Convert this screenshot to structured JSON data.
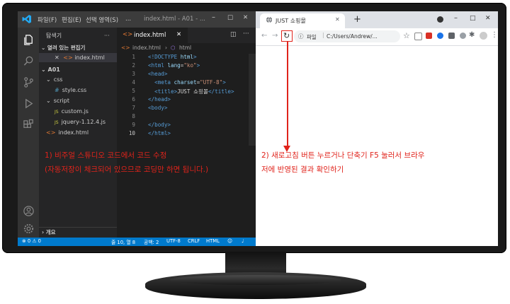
{
  "vscode": {
    "menu": [
      "파일(F)",
      "편집(E)",
      "선택 영역(S)",
      "..."
    ],
    "window_title": "index.html - A01 - ...",
    "explorer_title": "탐색기",
    "more": "···",
    "open_editors": "열려 있는 편집기",
    "open_file": "index.html",
    "folder_root": "A01",
    "tree": [
      {
        "label": "css",
        "kind": "folder",
        "level": 1
      },
      {
        "label": "style.css",
        "kind": "css",
        "level": 2
      },
      {
        "label": "script",
        "kind": "folder",
        "level": 1
      },
      {
        "label": "custom.js",
        "kind": "js",
        "level": 2
      },
      {
        "label": "jquery-1.12.4.js",
        "kind": "js",
        "level": 2
      },
      {
        "label": "index.html",
        "kind": "html",
        "level": 1
      }
    ],
    "outline": "개요",
    "tab_label": "index.html",
    "breadcrumb": [
      "index.html",
      "html"
    ],
    "code_lines": [
      [
        {
          "t": "<!DOCTYPE ",
          "c": "#569cd6"
        },
        {
          "t": "html",
          "c": "#9cdcfe"
        },
        {
          "t": ">",
          "c": "#569cd6"
        }
      ],
      [
        {
          "t": "<html ",
          "c": "#569cd6"
        },
        {
          "t": "lang",
          "c": "#9cdcfe"
        },
        {
          "t": "=",
          "c": "#d4d4d4"
        },
        {
          "t": "\"ko\"",
          "c": "#ce9178"
        },
        {
          "t": ">",
          "c": "#569cd6"
        }
      ],
      [
        {
          "t": "<head>",
          "c": "#569cd6"
        }
      ],
      [
        {
          "t": "  <meta ",
          "c": "#569cd6"
        },
        {
          "t": "charset",
          "c": "#9cdcfe"
        },
        {
          "t": "=",
          "c": "#d4d4d4"
        },
        {
          "t": "\"UTF-8\"",
          "c": "#ce9178"
        },
        {
          "t": ">",
          "c": "#569cd6"
        }
      ],
      [
        {
          "t": "  <title>",
          "c": "#569cd6"
        },
        {
          "t": "JUST 쇼핑몰",
          "c": "#d4d4d4"
        },
        {
          "t": "</title>",
          "c": "#569cd6"
        }
      ],
      [
        {
          "t": "</head>",
          "c": "#569cd6"
        }
      ],
      [
        {
          "t": "<body>",
          "c": "#569cd6"
        }
      ],
      [],
      [
        {
          "t": "</body>",
          "c": "#569cd6"
        }
      ],
      [
        {
          "t": "</html>",
          "c": "#569cd6"
        }
      ]
    ],
    "status": {
      "problems": "⊗ 0 ⚠ 0",
      "position": "줄 10, 열 8",
      "spaces": "공백: 2",
      "encoding": "UTF-8",
      "eol": "CRLF",
      "language": "HTML"
    }
  },
  "chrome": {
    "tab_title": "JUST 쇼핑몰",
    "address_label": "파일",
    "address": "C:/Users/Andrew/...",
    "new_tab": "+"
  },
  "annotations": {
    "left_line1": "1) 비주얼 스튜디오 코드에서 코드 수정",
    "left_line2": "(자동저장이 체크되어 있으므로 코딩만 하면 됩니다.)",
    "right_line1": "2) 새로고침 버튼 누르거나 단축기 F5 눌러서 브라우",
    "right_line2": "저에 반영된 결과 확인하기"
  },
  "colors": {
    "annotation": "#e0231b",
    "statusbar": "#007acc",
    "vscode_bg": "#1e1e1e"
  }
}
